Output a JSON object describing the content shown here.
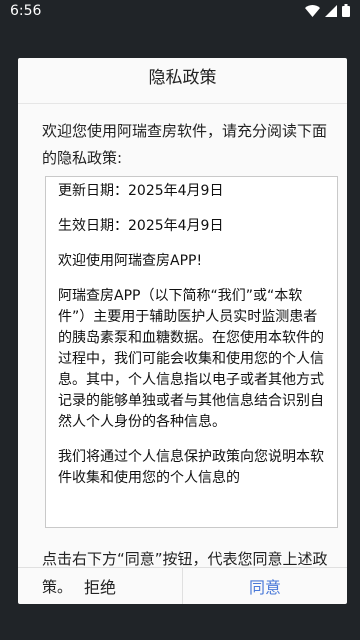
{
  "status_bar": {
    "time": "6:56"
  },
  "dialog": {
    "title": "隐私政策",
    "intro": "欢迎您使用阿瑞查房软件，请充分阅读下面的隐私政策:",
    "policy_paragraphs": [
      "更新日期：2025年4月9日",
      "生效日期：2025年4月9日",
      "欢迎使用阿瑞查房APP!",
      "阿瑞查房APP（以下简称“我们”或“本软件”）主要用于辅助医护人员实时监测患者的胰岛素泵和血糖数据。在您使用本软件的过程中，我们可能会收集和使用您的个人信息。其中，个人信息指以电子或者其他方式记录的能够单独或者与其他信息结合识别自然人个人身份的各种信息。",
      "我们将通过个人信息保护政策向您说明本软件收集和使用您的个人信息的"
    ],
    "outro": "点击右下方“同意”按钮，代表您同意上述政策。",
    "reject_label": "拒绝",
    "agree_label": "同意"
  },
  "colors": {
    "accent": "#4a79d8",
    "overlay": "#202428"
  }
}
